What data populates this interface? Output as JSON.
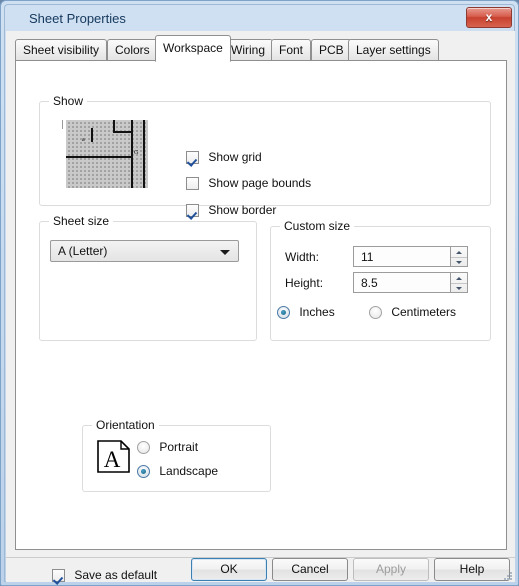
{
  "window": {
    "title": "Sheet Properties",
    "close_label": "x",
    "close_icon": "close-icon"
  },
  "tabs": [
    {
      "label": "Sheet visibility",
      "active": false
    },
    {
      "label": "Colors",
      "active": false
    },
    {
      "label": "Workspace",
      "active": true
    },
    {
      "label": "Wiring",
      "active": false
    },
    {
      "label": "Font",
      "active": false
    },
    {
      "label": "PCB",
      "active": false
    },
    {
      "label": "Layer settings",
      "active": false
    }
  ],
  "workspace": {
    "show_group": {
      "title": "Show",
      "preview": {
        "name": "sheet-preview-thumbnail",
        "label_a": "a",
        "label_b": "G"
      },
      "checkboxes": [
        {
          "label": "Show grid",
          "checked": true
        },
        {
          "label": "Show page bounds",
          "checked": false
        },
        {
          "label": "Show border",
          "checked": true
        }
      ]
    },
    "sheet_size_group": {
      "title": "Sheet size",
      "combo": {
        "value": "A (Letter)",
        "arrow_icon": "chevron-down-icon"
      },
      "orientation_group": {
        "title": "Orientation",
        "page_icon": "page-letter-a-icon",
        "options": [
          {
            "label": "Portrait",
            "selected": false
          },
          {
            "label": "Landscape",
            "selected": true
          }
        ]
      }
    },
    "custom_size_group": {
      "title": "Custom size",
      "width": {
        "label": "Width:",
        "value": "11"
      },
      "height": {
        "label": "Height:",
        "value": "8.5"
      },
      "units": [
        {
          "label": "Inches",
          "selected": true
        },
        {
          "label": "Centimeters",
          "selected": false
        }
      ]
    }
  },
  "footer": {
    "save_as_default": {
      "label": "Save as default",
      "checked": true
    },
    "buttons": [
      {
        "label": "OK",
        "default": true,
        "disabled": false
      },
      {
        "label": "Cancel",
        "default": false,
        "disabled": false
      },
      {
        "label": "Apply",
        "default": false,
        "disabled": true
      },
      {
        "label": "Help",
        "default": false,
        "disabled": false
      }
    ]
  },
  "colors": {
    "titlebar_accent": "#cfe0f2",
    "close_button": "#c8402f",
    "tab_panel_bg": "#ffffff",
    "radio_dot": "#14627f",
    "checkbox_check": "#21519b",
    "default_button_border": "#3c7fb1"
  }
}
